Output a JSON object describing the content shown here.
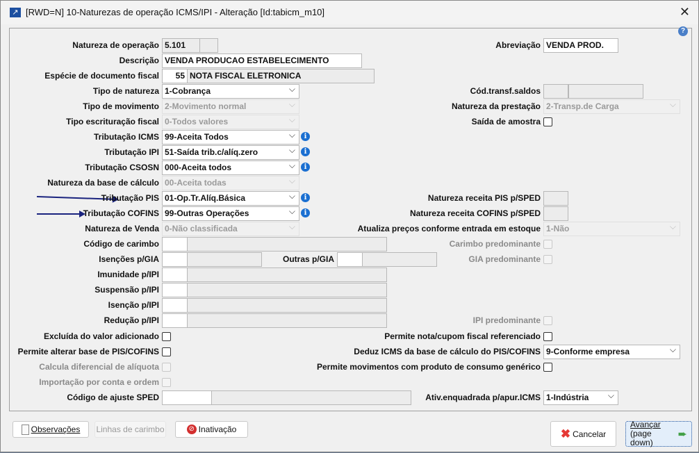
{
  "window": {
    "title": "[RWD=N] 10-Naturezas de operação ICMS/IPI - Alteração [Id:tabicm_m10]"
  },
  "left": {
    "natureza_operacao": {
      "label": "Natureza de operação",
      "value": "5.101"
    },
    "descricao": {
      "label": "Descrição",
      "value": "VENDA PRODUCAO ESTABELECIMENTO"
    },
    "especie": {
      "label": "Espécie de documento fiscal",
      "code": "55",
      "value": "NOTA FISCAL ELETRONICA"
    },
    "tipo_natureza": {
      "label": "Tipo de natureza",
      "value": "1-Cobrança"
    },
    "tipo_movimento": {
      "label": "Tipo de movimento",
      "value": "2-Movimento normal"
    },
    "tipo_escrituracao": {
      "label": "Tipo escrituração fiscal",
      "value": "0-Todos valores"
    },
    "trib_icms": {
      "label": "Tributação ICMS",
      "value": "99-Aceita Todos"
    },
    "trib_ipi": {
      "label": "Tributação IPI",
      "value": "51-Saída trib.c/alíq.zero"
    },
    "trib_csosn": {
      "label": "Tributação CSOSN",
      "value": "000-Aceita todos"
    },
    "nat_base": {
      "label": "Natureza da base de cálculo",
      "value": "00-Aceita todas"
    },
    "trib_pis": {
      "label": "Tributação PIS",
      "value": "01-Op.Tr.Alíq.Básica"
    },
    "trib_cofins": {
      "label": "Tributação COFINS",
      "value": "99-Outras Operações"
    },
    "nat_venda": {
      "label": "Natureza de Venda",
      "value": "0-Não classificada"
    },
    "cod_carimbo": {
      "label": "Código de carimbo"
    },
    "isencoes_gia": {
      "label": "Isenções p/GIA"
    },
    "outras_gia": {
      "label": "Outras p/GIA"
    },
    "imunidade_ipi": {
      "label": "Imunidade p/IPI"
    },
    "suspensao_ipi": {
      "label": "Suspensão p/IPI"
    },
    "isencao_ipi": {
      "label": "Isenção p/IPI"
    },
    "reducao_ipi": {
      "label": "Redução p/IPI"
    },
    "excluida": {
      "label": "Excluída do valor adicionado"
    },
    "permite_alterar": {
      "label": "Permite alterar base de PIS/COFINS"
    },
    "calcula_dif": {
      "label": "Calcula diferencial de alíquota"
    },
    "importacao": {
      "label": "Importação por conta e ordem"
    },
    "cod_ajuste": {
      "label": "Código de ajuste SPED"
    }
  },
  "right": {
    "abreviacao": {
      "label": "Abreviação",
      "value": "VENDA PROD."
    },
    "cod_transf": {
      "label": "Cód.transf.saldos"
    },
    "nat_prestacao": {
      "label": "Natureza da prestação",
      "value": "2-Transp.de Carga"
    },
    "saida_amostra": {
      "label": "Saída de amostra"
    },
    "nat_rec_pis": {
      "label": "Natureza receita PIS p/SPED"
    },
    "nat_rec_cofins": {
      "label": "Natureza receita COFINS p/SPED"
    },
    "atualiza_precos": {
      "label": "Atualiza preços conforme entrada em estoque",
      "value": "1-Não"
    },
    "carimbo_pred": {
      "label": "Carimbo predominante"
    },
    "gia_pred": {
      "label": "GIA predominante"
    },
    "ipi_pred": {
      "label": "IPI predominante"
    },
    "permite_nota": {
      "label": "Permite nota/cupom fiscal referenciado"
    },
    "deduz_icms": {
      "label": "Deduz ICMS da base de cálculo do PIS/COFINS",
      "value": "9-Conforme empresa"
    },
    "permite_mov": {
      "label": "Permite movimentos com produto de consumo genérico"
    },
    "ativ_enq": {
      "label": "Ativ.enquadrada p/apur.ICMS",
      "value": "1-Indústria"
    }
  },
  "buttons": {
    "observacoes": "Observações",
    "linhas": "Linhas de carimbo",
    "inativacao": "Inativação",
    "cancelar": "Cancelar",
    "avancar": "Avançar",
    "avancar_sub": "(page down)"
  }
}
